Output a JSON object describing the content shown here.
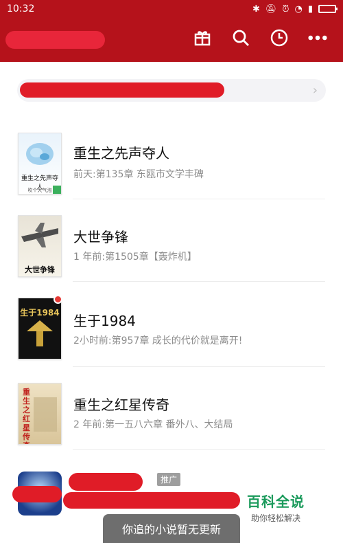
{
  "status_bar": {
    "time": "10:32"
  },
  "app_bar": {
    "actions": [
      "gift-icon",
      "search-icon",
      "history-icon",
      "more-icon"
    ]
  },
  "search": {
    "chevron": "›"
  },
  "books": [
    {
      "cover_title": "重生之先声夺人",
      "cover_sub": "吹个大气泡",
      "title": "重生之先声夺人",
      "meta": "前天:第135章 东瓯市文学丰碑"
    },
    {
      "cover_title": "大世争锋",
      "title": "大世争锋",
      "meta": "1 年前:第1505章【轰炸机】"
    },
    {
      "cover_title": "生于1984",
      "title": "生于1984",
      "meta": "2小时前:第957章 成长的代价就是离开!"
    },
    {
      "cover_title": "重生之红星传奇",
      "title": "重生之红星传奇",
      "meta": "2 年前:第一五八六章 番外八、大结局"
    }
  ],
  "ad": {
    "tag": "推广"
  },
  "watermark": {
    "title": "百科全说",
    "subtitle": "助你轻松解决"
  },
  "toast": {
    "text": "你追的小说暂无更新"
  },
  "colors": {
    "primary": "#b5121b",
    "redaction": "#e01c27"
  }
}
